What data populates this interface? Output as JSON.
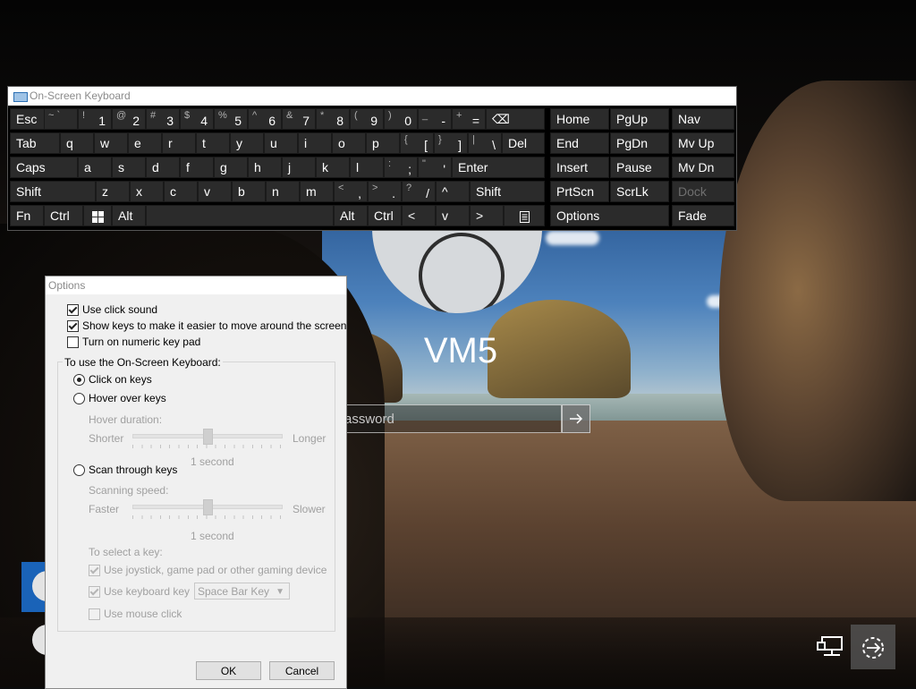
{
  "login": {
    "username": "VM5",
    "password_placeholder": "assword"
  },
  "osk": {
    "title": "On-Screen Keyboard",
    "keys": {
      "esc": "Esc",
      "tilde": {
        "s": "~ `",
        "p": ""
      },
      "k1": {
        "s": "!",
        "p": "1"
      },
      "k2": {
        "s": "@",
        "p": "2"
      },
      "k3": {
        "s": "#",
        "p": "3"
      },
      "k4": {
        "s": "$",
        "p": "4"
      },
      "k5": {
        "s": "%",
        "p": "5"
      },
      "k6": {
        "s": "^",
        "p": "6"
      },
      "k7": {
        "s": "&",
        "p": "7"
      },
      "k8": {
        "s": "*",
        "p": "8"
      },
      "k9": {
        "s": "(",
        "p": "9"
      },
      "k0": {
        "s": ")",
        "p": "0"
      },
      "minus": {
        "s": "_",
        "p": "-"
      },
      "equal": {
        "s": "+",
        "p": "="
      },
      "backspace": "⌫",
      "tab": "Tab",
      "q": "q",
      "w": "w",
      "e": "e",
      "r": "r",
      "t": "t",
      "y": "y",
      "u": "u",
      "i": "i",
      "o": "o",
      "p": "p",
      "lbracket": {
        "s": "{",
        "p": "["
      },
      "rbracket": {
        "s": "}",
        "p": "]"
      },
      "backslash": {
        "s": "|",
        "p": "\\"
      },
      "del": "Del",
      "caps": "Caps",
      "a": "a",
      "s": "s",
      "d": "d",
      "f": "f",
      "g": "g",
      "h": "h",
      "j": "j",
      "k": "k",
      "l": "l",
      "semicolon": {
        "s": ":",
        "p": ";"
      },
      "quote": {
        "s": "\"",
        "p": "'"
      },
      "enter": "Enter",
      "shift_l": "Shift",
      "z": "z",
      "x": "x",
      "c": "c",
      "v": "v",
      "b": "b",
      "n": "n",
      "m": "m",
      "comma": {
        "s": "<",
        "p": ","
      },
      "period": {
        "s": ">",
        "p": "."
      },
      "slash": {
        "s": "?",
        "p": "/"
      },
      "up": "^",
      "shift_r": "Shift",
      "fn": "Fn",
      "ctrl_l": "Ctrl",
      "alt_l": "Alt",
      "alt_r": "Alt",
      "ctrl_r": "Ctrl",
      "left": "<",
      "down": "v",
      "right": ">",
      "home": "Home",
      "pgup": "PgUp",
      "nav": "Nav",
      "end": "End",
      "pgdn": "PgDn",
      "mvup": "Mv Up",
      "insert": "Insert",
      "pause": "Pause",
      "mvdn": "Mv Dn",
      "prtscn": "PrtScn",
      "scrlk": "ScrLk",
      "dock": "Dock",
      "options": "Options",
      "fade": "Fade"
    }
  },
  "options_dialog": {
    "title": "Options",
    "use_click_sound": {
      "label": "Use click sound",
      "checked": true
    },
    "show_keys": {
      "label": "Show keys to make it easier to move around the screen",
      "checked": true
    },
    "numeric_keypad": {
      "label": "Turn on numeric key pad",
      "checked": false
    },
    "group_label": "To use the On-Screen Keyboard:",
    "click_on_keys": "Click on keys",
    "hover_over_keys": "Hover over keys",
    "hover_duration_label": "Hover duration:",
    "hover_shorter": "Shorter",
    "hover_longer": "Longer",
    "hover_value": "1 second",
    "scan_through_keys": "Scan through keys",
    "scanning_speed_label": "Scanning speed:",
    "scan_faster": "Faster",
    "scan_slower": "Slower",
    "scan_value": "1 second",
    "to_select_label": "To select a key:",
    "use_joystick": {
      "label": "Use joystick, game pad or other gaming device",
      "checked": true
    },
    "use_keyboard_key": {
      "label": "Use keyboard key",
      "checked": true
    },
    "keyboard_key_value": "Space Bar Key",
    "use_mouse_click": {
      "label": "Use mouse click",
      "checked": false
    },
    "ok": "OK",
    "cancel": "Cancel"
  }
}
